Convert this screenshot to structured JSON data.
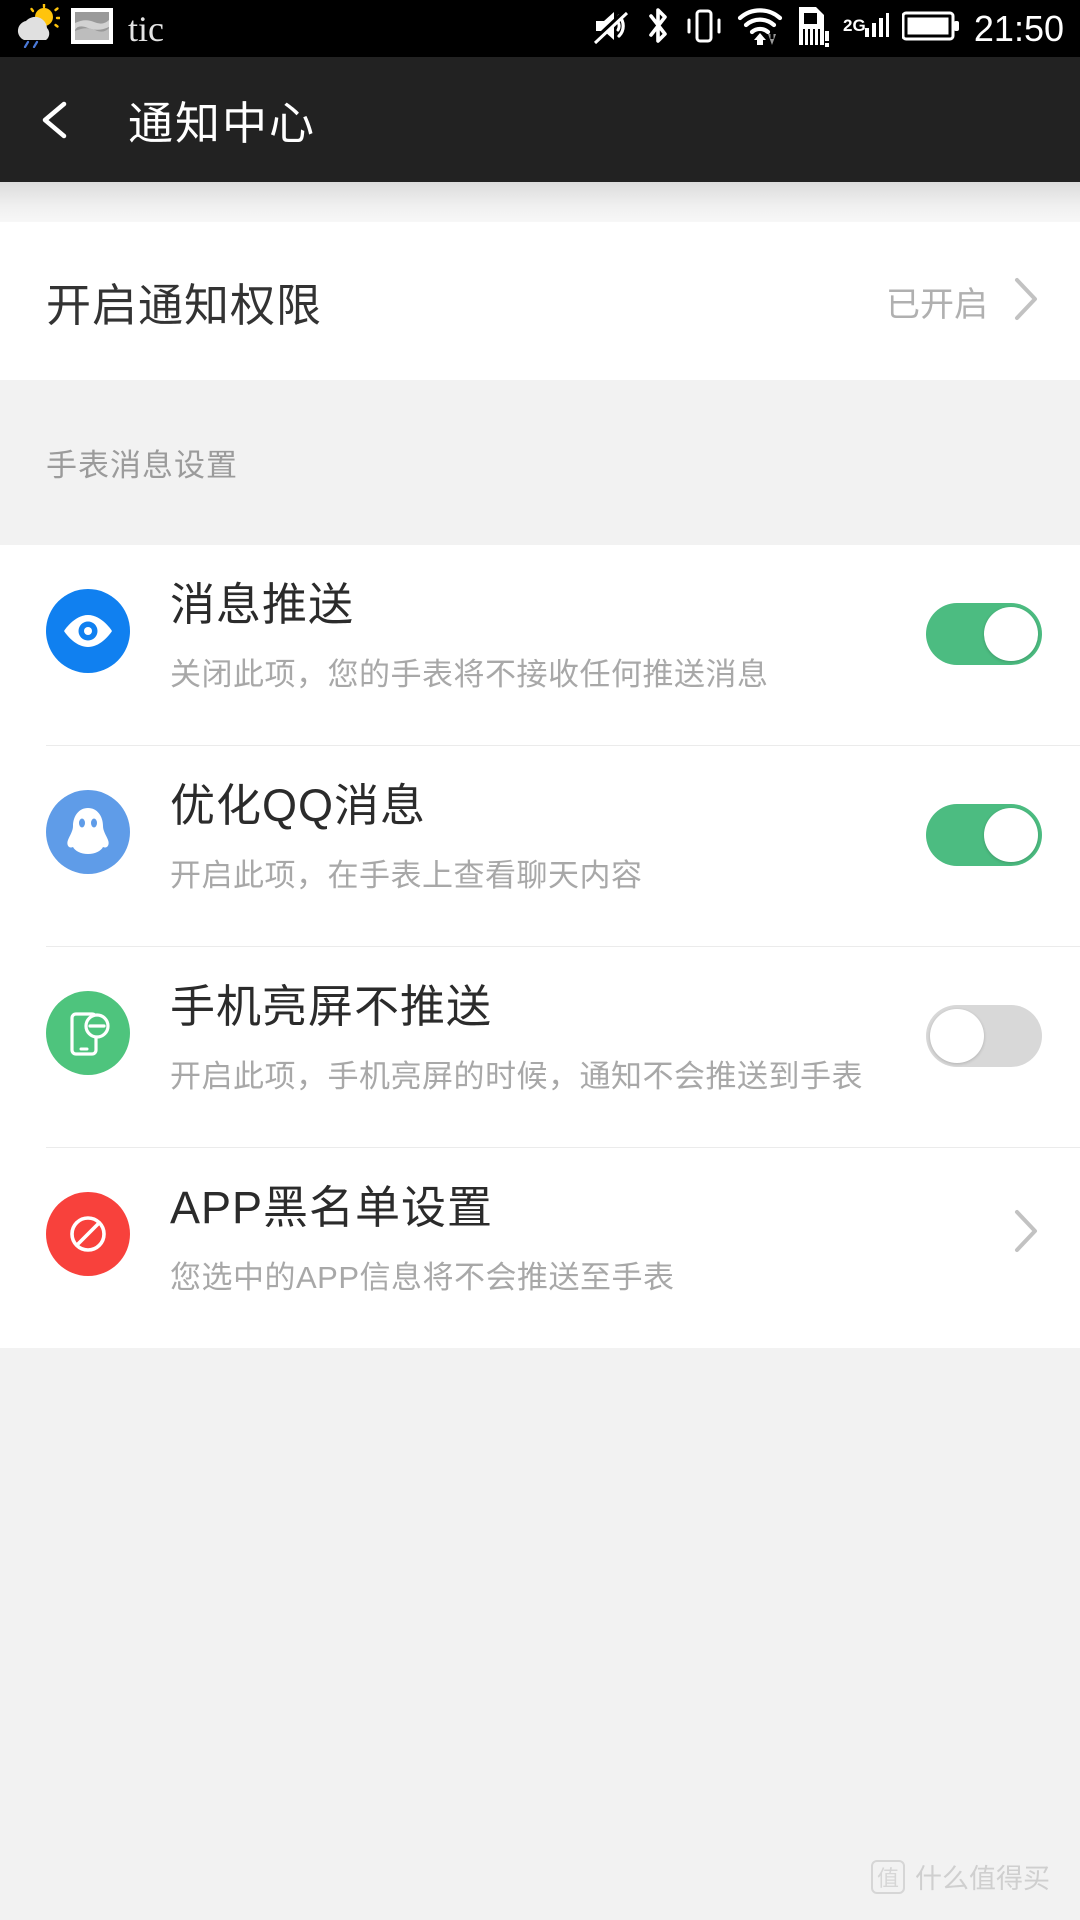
{
  "statusbar": {
    "clock": "21:50",
    "carrier_label": "tic",
    "left_icons": [
      "weather-sun-cloud-icon",
      "photo-icon"
    ],
    "right_icons": [
      "mute-vibrate-icon",
      "bluetooth-icon",
      "vibration-icon",
      "wifi-icon",
      "sim-card-alert-icon",
      "signal-2g-icon",
      "battery-icon"
    ],
    "signal_label": "2G"
  },
  "appbar": {
    "back_icon": "back-chevron-icon",
    "title": "通知中心"
  },
  "permission_row": {
    "title": "开启通知权限",
    "status": "已开启",
    "chevron": "chevron-right-icon"
  },
  "section": {
    "label": "手表消息设置"
  },
  "settings": [
    {
      "icon": "eye-icon",
      "icon_color": "#1080f0",
      "title": "消息推送",
      "subtitle": "关闭此项，您的手表将不接收任何推送消息",
      "control": "toggle",
      "toggle_on": true
    },
    {
      "icon": "qq-penguin-icon",
      "icon_color": "#5f9ce8",
      "title": "优化QQ消息",
      "subtitle": "开启此项，在手表上查看聊天内容",
      "control": "toggle",
      "toggle_on": true
    },
    {
      "icon": "phone-screen-off-icon",
      "icon_color": "#4ec47d",
      "title": "手机亮屏不推送",
      "subtitle": "开启此项，手机亮屏的时候，通知不会推送到手表",
      "control": "toggle",
      "toggle_on": false
    },
    {
      "icon": "block-forbidden-icon",
      "icon_color": "#f8413c",
      "title": "APP黑名单设置",
      "subtitle": "您选中的APP信息将不会推送至手表",
      "control": "chevron",
      "toggle_on": null
    }
  ],
  "watermark": {
    "badge": "值",
    "text": "什么值得买"
  },
  "colors": {
    "toggle_on": "#4cbc81",
    "toggle_off": "#d8d8d8",
    "appbar_bg": "#222222",
    "statusbar_bg": "#000000",
    "page_bg": "#f2f2f2"
  }
}
